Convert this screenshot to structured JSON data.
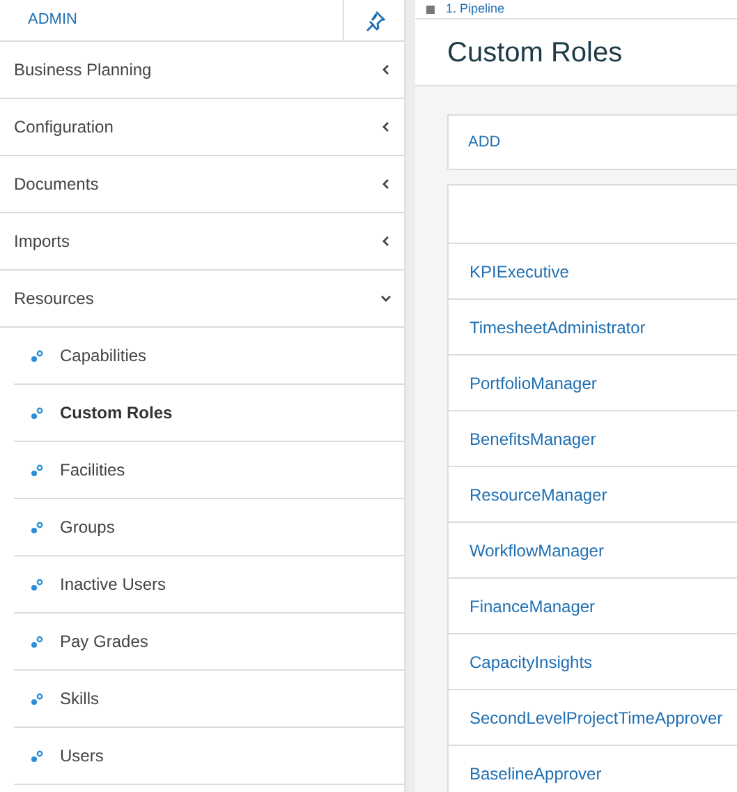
{
  "sidebar": {
    "title": "ADMIN",
    "pinned": false,
    "items": [
      {
        "label": "Business Planning",
        "expanded": false
      },
      {
        "label": "Configuration",
        "expanded": false
      },
      {
        "label": "Documents",
        "expanded": false
      },
      {
        "label": "Imports",
        "expanded": false
      },
      {
        "label": "Resources",
        "expanded": true,
        "children": [
          {
            "label": "Capabilities",
            "selected": false
          },
          {
            "label": "Custom Roles",
            "selected": true
          },
          {
            "label": "Facilities",
            "selected": false
          },
          {
            "label": "Groups",
            "selected": false
          },
          {
            "label": "Inactive Users",
            "selected": false
          },
          {
            "label": "Pay Grades",
            "selected": false
          },
          {
            "label": "Skills",
            "selected": false
          },
          {
            "label": "Users",
            "selected": false
          }
        ]
      }
    ]
  },
  "breadcrumb": "1. Pipeline",
  "page_title": "Custom Roles",
  "add_button": "ADD",
  "table": {
    "rows": [
      "KPIExecutive",
      "TimesheetAdministrator",
      "PortfolioManager",
      "BenefitsManager",
      "ResourceManager",
      "WorkflowManager",
      "FinanceManager",
      "CapacityInsights",
      "SecondLevelProjectTimeApprover",
      "BaselineApprover"
    ]
  }
}
